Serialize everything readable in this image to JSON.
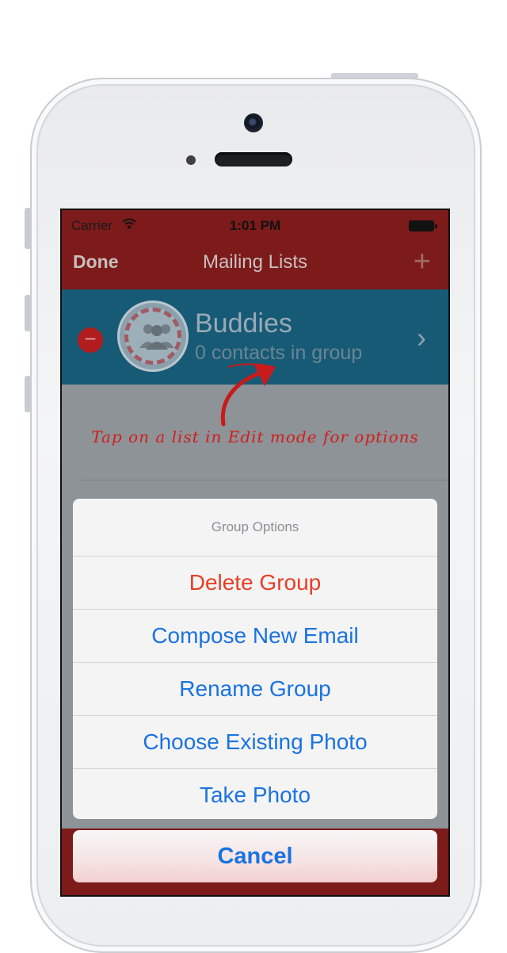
{
  "status_bar": {
    "carrier": "Carrier",
    "wifi_icon": "wifi-icon",
    "time": "1:01 PM",
    "battery_icon": "battery-icon"
  },
  "nav_bar": {
    "left_button": "Done",
    "title": "Mailing Lists",
    "right_icon": "plus-icon"
  },
  "list": {
    "group_name": "Buddies",
    "group_count": "0 contacts in group"
  },
  "annotation": "Tap on a list in Edit mode for options",
  "action_sheet": {
    "title": "Group Options",
    "items": [
      {
        "label": "Delete Group",
        "style": "destructive"
      },
      {
        "label": "Compose New Email",
        "style": "default"
      },
      {
        "label": "Rename Group",
        "style": "default"
      },
      {
        "label": "Choose Existing Photo",
        "style": "default"
      },
      {
        "label": "Take Photo",
        "style": "default"
      }
    ],
    "cancel": "Cancel"
  },
  "colors": {
    "nav_bar": "#7c1b1a",
    "list_row": "#175a76",
    "action_blue": "#1a73e0",
    "destructive_red": "#e64025",
    "annotation_red": "#d21d1d"
  }
}
